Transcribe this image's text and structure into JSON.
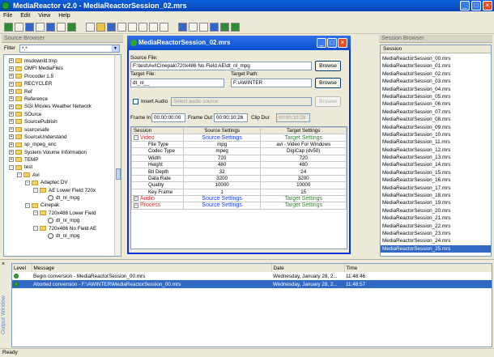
{
  "app": {
    "title": "MediaReactor v2.0  -  MediaReactorSession_02.mrs"
  },
  "menu": [
    "File",
    "Edit",
    "View",
    "Help"
  ],
  "source_browser": {
    "title": "Source Browser",
    "filter_label": "Filter",
    "filter_value": "*.*",
    "items": [
      {
        "label": "msdownld.tmp",
        "indent": 0,
        "type": "folder",
        "expander": "+"
      },
      {
        "label": "OMFI MediaFiles",
        "indent": 0,
        "type": "folder",
        "expander": "+"
      },
      {
        "label": "Procoder 1.5",
        "indent": 0,
        "type": "folder",
        "expander": "+"
      },
      {
        "label": "RECYCLER",
        "indent": 0,
        "type": "folder",
        "expander": "+"
      },
      {
        "label": "Ref",
        "indent": 0,
        "type": "folder",
        "expander": "+"
      },
      {
        "label": "Reference",
        "indent": 0,
        "type": "folder",
        "expander": "+"
      },
      {
        "label": "SGI Movies Weather Network",
        "indent": 0,
        "type": "folder",
        "expander": "+"
      },
      {
        "label": "SOurce",
        "indent": 0,
        "type": "folder",
        "expander": "+"
      },
      {
        "label": "SourcePublish",
        "indent": 0,
        "type": "folder",
        "expander": "+"
      },
      {
        "label": "sourcesafe",
        "indent": 0,
        "type": "folder",
        "expander": "+"
      },
      {
        "label": "SourceUnderstand",
        "indent": 0,
        "type": "folder",
        "expander": "+"
      },
      {
        "label": "sp_mpeg_enc",
        "indent": 0,
        "type": "folder",
        "expander": "+"
      },
      {
        "label": "System Volume Information",
        "indent": 0,
        "type": "folder",
        "expander": "+"
      },
      {
        "label": "TEMP",
        "indent": 0,
        "type": "folder",
        "expander": "+"
      },
      {
        "label": "test",
        "indent": 0,
        "type": "folder",
        "expander": "-"
      },
      {
        "label": "Avi",
        "indent": 1,
        "type": "folder",
        "expander": "-"
      },
      {
        "label": "Adaptec DV",
        "indent": 2,
        "type": "folder",
        "expander": "-"
      },
      {
        "label": "AE Lower Field 720x",
        "indent": 3,
        "type": "folder",
        "expander": "-"
      },
      {
        "label": "dt_nl_mpg",
        "indent": 4,
        "type": "file",
        "expander": ""
      },
      {
        "label": "Cinepak",
        "indent": 2,
        "type": "folder",
        "expander": "-"
      },
      {
        "label": "720x486 Lower Field",
        "indent": 3,
        "type": "folder",
        "expander": "-"
      },
      {
        "label": "dt_nl_mpg",
        "indent": 4,
        "type": "file",
        "expander": ""
      },
      {
        "label": "720x486 No Field AE",
        "indent": 3,
        "type": "folder",
        "expander": "-"
      },
      {
        "label": "dt_nl_mpg",
        "indent": 4,
        "type": "file",
        "expander": ""
      }
    ]
  },
  "dialog": {
    "title": "MediaReactorSession_02.mrs",
    "source_file_label": "Source File:",
    "source_file_value": "F:\\test\\Avi\\Cinepak\\720x486 No Field AE\\dt_nl_mpg",
    "browse_label": "Browse",
    "target_file_label": "Target File:",
    "target_file_value": "dt_nl__",
    "target_path_label": "Target Path:",
    "target_path_value": "F:\\AWINTER",
    "insert_audio_label": "Insert Audio",
    "audio_placeholder": "Select audio source",
    "frame_in_label": "Frame In",
    "frame_in_value": "00:00:00:00",
    "frame_out_label": "Frame Out",
    "frame_out_value": "00:00:10:26",
    "clip_dur_label": "Clip Dur",
    "clip_dur_value": "00:00:10:26",
    "table_headers": [
      "Session",
      "Source Settings",
      "Target Settings"
    ],
    "rows": [
      {
        "name": "Video",
        "source": "Source Settings",
        "target": "Target Settings",
        "kind": "group",
        "expander": "-"
      },
      {
        "name": "File Type",
        "source": "mpg",
        "target": "avi - Video For Windows",
        "kind": "prop"
      },
      {
        "name": "Codec Type",
        "source": "mpeg",
        "target": "DigiCap (dv50)",
        "kind": "prop"
      },
      {
        "name": "Width",
        "source": "720",
        "target": "720",
        "kind": "prop"
      },
      {
        "name": "Height",
        "source": "480",
        "target": "480",
        "kind": "prop"
      },
      {
        "name": "Bit Depth",
        "source": "32",
        "target": "24",
        "kind": "prop"
      },
      {
        "name": "Data Rate",
        "source": "3200",
        "target": "3200",
        "kind": "prop"
      },
      {
        "name": "Quality",
        "source": "10000",
        "target": "10000",
        "kind": "prop"
      },
      {
        "name": "Key Frame",
        "source": "1",
        "target": "15",
        "kind": "prop"
      },
      {
        "name": "Audio",
        "source": "Source Settings",
        "target": "Target Settings",
        "kind": "group",
        "expander": "+"
      },
      {
        "name": "Process",
        "source": "Source Settings",
        "target": "Target Settings",
        "kind": "group",
        "expander": "+"
      }
    ]
  },
  "session_browser": {
    "title": "Session Browser",
    "column": "Session",
    "items": [
      "MediaReactorSession_00.mrs",
      "MediaReactorSession_01.mrs",
      "MediaReactorSession_02.mrs",
      "MediaReactorSession_03.mrs",
      "MediaReactorSession_04.mrs",
      "MediaReactorSession_05.mrs",
      "MediaReactorSession_06.mrs",
      "MediaReactorSession_07.mrs",
      "MediaReactorSession_08.mrs",
      "MediaReactorSession_09.mrs",
      "MediaReactorSession_10.mrs",
      "MediaReactorSession_11.mrs",
      "MediaReactorSession_12.mrs",
      "MediaReactorSession_13.mrs",
      "MediaReactorSession_14.mrs",
      "MediaReactorSession_15.mrs",
      "MediaReactorSession_16.mrs",
      "MediaReactorSession_17.mrs",
      "MediaReactorSession_18.mrs",
      "MediaReactorSession_19.mrs",
      "MediaReactorSession_20.mrs",
      "MediaReactorSession_21.mrs",
      "MediaReactorSession_22.mrs",
      "MediaReactorSession_23.mrs",
      "MediaReactorSession_24.mrs",
      "MediaReactorSession_25.mrs"
    ],
    "selected_index": 25
  },
  "output": {
    "side_label": "Output Window",
    "headers": [
      "Level",
      "Message",
      "Date",
      "Time"
    ],
    "rows": [
      {
        "message": "Begin conversion - MediaReactorSession_00.mrs",
        "date": "Wednesday, January 28, 2...",
        "time": "11:48:46",
        "selected": false
      },
      {
        "message": "Aborted conversion - F:\\AWINTER\\MediaReactorSession_00.mrs",
        "date": "Wednesday, January 28, 2...",
        "time": "11:48:57",
        "selected": true
      }
    ]
  },
  "status": "Ready",
  "colors": {
    "titlebar": "#0a5fd8",
    "selection": "#316ac5",
    "group_red": "#d03030",
    "source_blue": "#1a3cff",
    "target_green": "#2a8a2a"
  }
}
